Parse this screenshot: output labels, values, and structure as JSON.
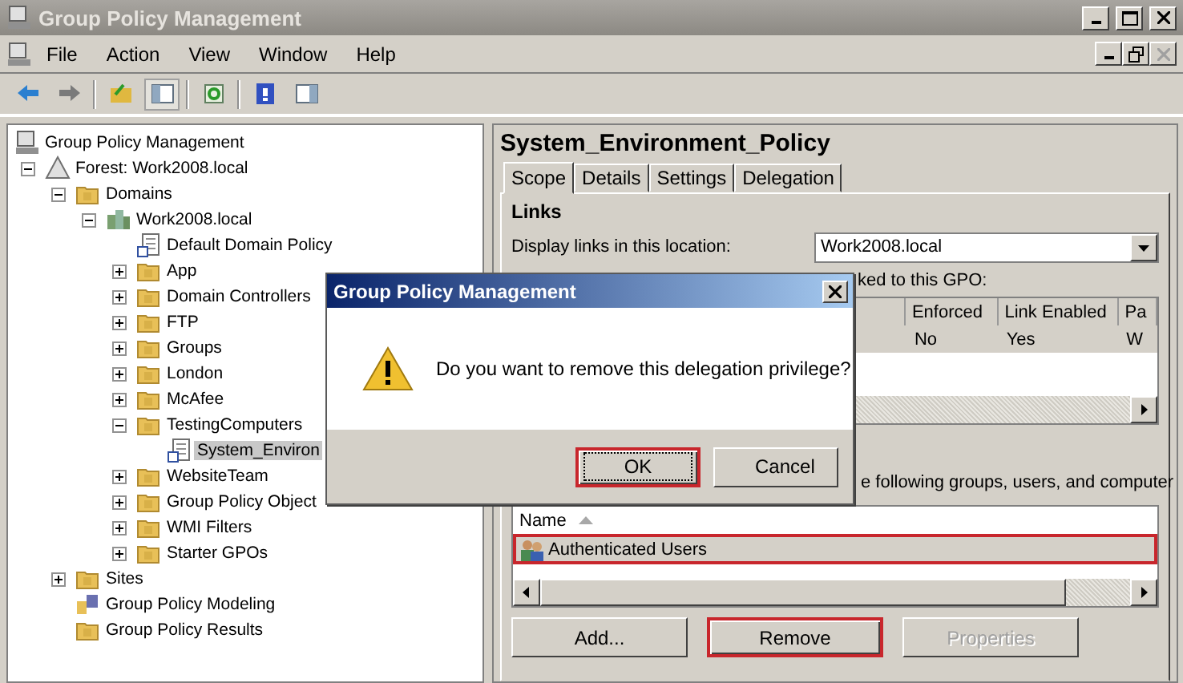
{
  "window": {
    "title": "Group Policy Management"
  },
  "menu": [
    "File",
    "Action",
    "View",
    "Window",
    "Help"
  ],
  "toolbar": [
    {
      "kind": "back"
    },
    {
      "kind": "forward"
    },
    {
      "kind": "up"
    },
    {
      "kind": "pane",
      "selected": true
    },
    {
      "kind": "refresh"
    },
    {
      "kind": "help"
    },
    {
      "kind": "action-pane"
    }
  ],
  "tree": [
    {
      "label": "Group Policy Management",
      "kind": "console",
      "selected": false,
      "children": [
        {
          "label": "Forest: Work2008.local",
          "kind": "forest",
          "selected": false,
          "expanded": true,
          "children": [
            {
              "label": "Domains",
              "kind": "folder",
              "selected": false,
              "expanded": true,
              "children": [
                {
                  "label": "Work2008.local",
                  "kind": "domain",
                  "selected": false,
                  "expanded": true,
                  "children": [
                    {
                      "label": "Default Domain Policy",
                      "kind": "gpo",
                      "selected": false
                    },
                    {
                      "label": "App",
                      "kind": "folder",
                      "selected": false,
                      "expanded": false
                    },
                    {
                      "label": "Domain Controllers",
                      "kind": "folder",
                      "selected": false,
                      "expanded": false
                    },
                    {
                      "label": "FTP",
                      "kind": "folder",
                      "selected": false,
                      "expanded": false
                    },
                    {
                      "label": "Groups",
                      "kind": "folder",
                      "selected": false,
                      "expanded": false
                    },
                    {
                      "label": "London",
                      "kind": "folder",
                      "selected": false,
                      "expanded": false
                    },
                    {
                      "label": "McAfee",
                      "kind": "folder",
                      "selected": false,
                      "expanded": false
                    },
                    {
                      "label": "TestingComputers",
                      "kind": "folder",
                      "selected": false,
                      "expanded": true,
                      "children": [
                        {
                          "label": "System_Environ",
                          "kind": "gpo",
                          "selected": true
                        }
                      ]
                    },
                    {
                      "label": "WebsiteTeam",
                      "kind": "folder",
                      "selected": false,
                      "expanded": false
                    },
                    {
                      "label": "Group Policy Object",
                      "kind": "folder",
                      "selected": false,
                      "expanded": false
                    },
                    {
                      "label": "WMI Filters",
                      "kind": "folder",
                      "selected": false,
                      "expanded": false
                    },
                    {
                      "label": "Starter GPOs",
                      "kind": "folder",
                      "selected": false,
                      "expanded": false
                    }
                  ]
                }
              ]
            },
            {
              "label": "Sites",
              "kind": "folder",
              "selected": false,
              "expanded": false
            },
            {
              "label": "Group Policy Modeling",
              "kind": "modeling",
              "selected": false
            },
            {
              "label": "Group Policy Results",
              "kind": "folder",
              "selected": false
            }
          ]
        }
      ]
    }
  ],
  "details": {
    "title": "System_Environment_Policy",
    "tabs": [
      {
        "label": "Scope",
        "selected": true
      },
      {
        "label": "Details",
        "selected": false
      },
      {
        "label": "Settings",
        "selected": false
      },
      {
        "label": "Delegation",
        "selected": false
      }
    ],
    "links_heading": "Links",
    "location_label": "Display links in this location:",
    "location_value": "Work2008.local",
    "links_caption_fragment": "ked to this GPO:",
    "links_table": {
      "columns": [
        "Enforced",
        "Link Enabled",
        "Pa"
      ],
      "rows": [
        [
          "No",
          "Yes",
          "W"
        ]
      ]
    },
    "filter_caption_fragment": "e following groups, users, and computer",
    "filter_table": {
      "column": "Name",
      "rows": [
        {
          "name": "Authenticated Users",
          "highlighted": true
        }
      ]
    },
    "buttons": [
      {
        "label": "Add...",
        "disabled": false,
        "highlighted": false
      },
      {
        "label": "Remove",
        "disabled": false,
        "highlighted": true
      },
      {
        "label": "Properties",
        "disabled": true,
        "highlighted": false
      }
    ]
  },
  "dialog": {
    "title": "Group Policy Management",
    "message": "Do you want to remove this delegation privilege?",
    "buttons": [
      {
        "label": "OK",
        "focused": true,
        "highlighted": true
      },
      {
        "label": "Cancel",
        "focused": false,
        "highlighted": false
      }
    ]
  }
}
